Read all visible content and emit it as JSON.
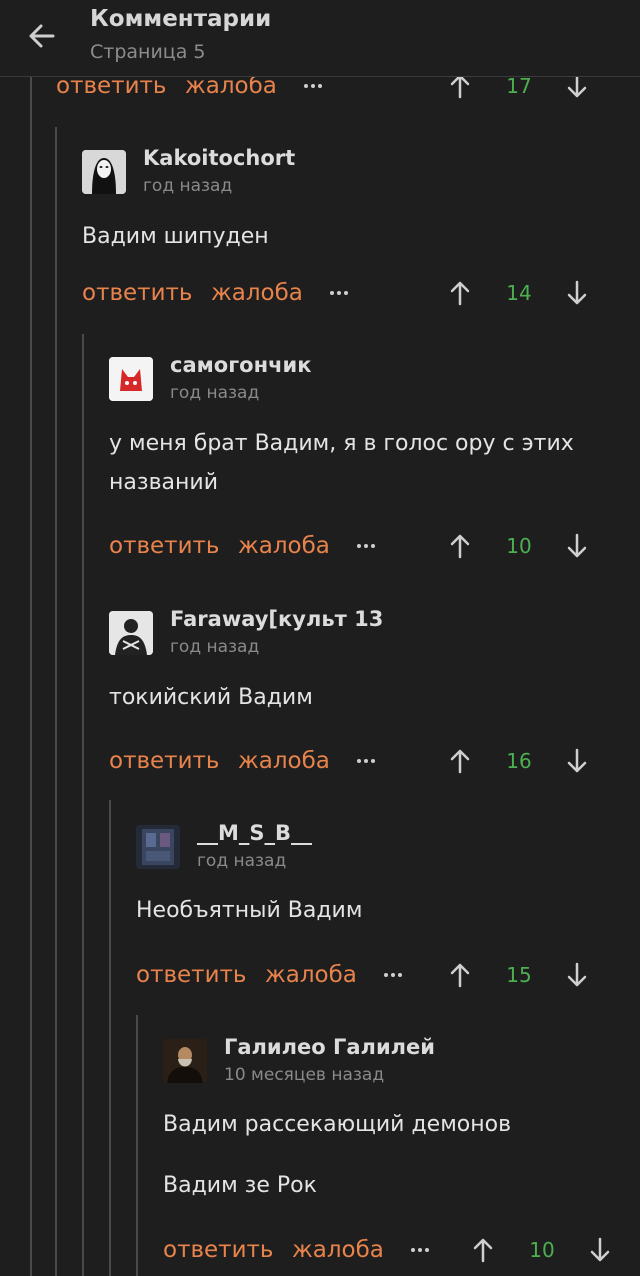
{
  "header": {
    "title": "Комментарии",
    "subtitle": "Страница 5"
  },
  "labels": {
    "reply": "ответить",
    "complain": "жалоба"
  },
  "top_actions": {
    "score": "17"
  },
  "comments": [
    {
      "user": "Kakoitochort",
      "time": "год назад",
      "text": [
        "Вадим шипуден"
      ],
      "score": "14"
    },
    {
      "user": "самогончик",
      "time": "год назад",
      "text": [
        "у меня брат Вадим, я в голос ору с этих",
        "названий"
      ],
      "score": "10"
    },
    {
      "user": "Faraway[культ 13",
      "time": "год назад",
      "text": [
        "токийский Вадим"
      ],
      "score": "16"
    },
    {
      "user": "__M_S_B__",
      "time": "год назад",
      "text": [
        "Необъятный Вадим"
      ],
      "score": "15"
    },
    {
      "user": "Галилео Галилей",
      "time": "10 месяцев назад",
      "text": [
        "Вадим рассекающий демонов",
        "Вадим зе Рок"
      ],
      "score": "10"
    }
  ],
  "colors": {
    "accent": "#e8834c",
    "score": "#4caf50",
    "background": "#1e1e1e"
  },
  "icons": {
    "back": "arrow-left-icon",
    "up": "arrow-up-icon",
    "down": "arrow-down-icon",
    "more": "more-dots-icon"
  }
}
